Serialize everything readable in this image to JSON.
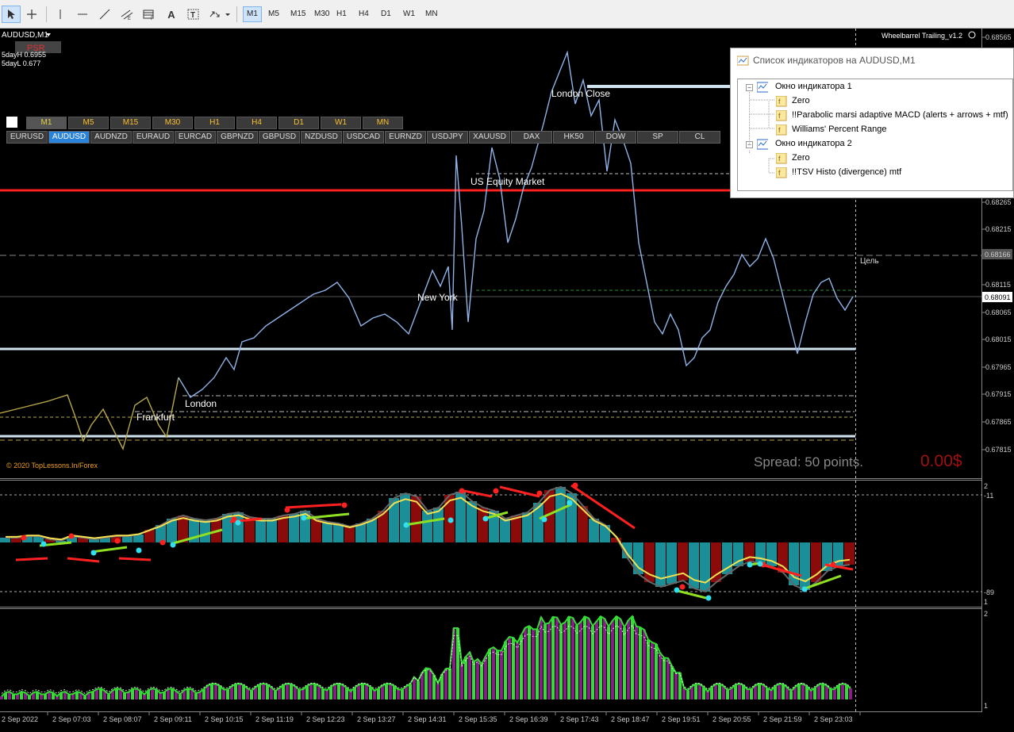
{
  "toolbar": {
    "timeframes": [
      "M1",
      "M5",
      "M15",
      "M30",
      "H1",
      "H4",
      "D1",
      "W1",
      "MN"
    ],
    "selected_timeframe": "M1",
    "tools": [
      "cursor-icon",
      "crosshair-icon",
      "vertical-line-icon",
      "horizontal-line-icon",
      "trendline-icon",
      "channel-icon",
      "fibonacci-icon",
      "text-icon",
      "text-label-icon",
      "arrows-icon"
    ]
  },
  "chart": {
    "symbol_title": "AUDUSD,M1",
    "psr_label": "PSR",
    "day_high": "5dayH 0.6955",
    "day_low": "5dayL 0.677",
    "copyright": "© 2020 TopLessons.In/Forex",
    "spread_text": "Spread: 50 points.",
    "profit_text": "0.00$",
    "ea_name": "Wheelbarrel Trailing_v1.2",
    "target_label": "Цель",
    "session_labels": {
      "london_close": "London Close",
      "us_equity": "US Equity Market",
      "new_york": "New York",
      "london": "London",
      "frankfurt": "Frankfurt"
    },
    "current_price": "0.68091",
    "target_price": "0.68166",
    "price_axis": [
      "0.68565",
      "0.68265",
      "0.68215",
      "0.68115",
      "0.68065",
      "0.68015",
      "0.67965",
      "0.67915",
      "0.67865",
      "0.67815"
    ],
    "time_axis": [
      "2 Sep 2022",
      "2 Sep 07:03",
      "2 Sep 08:07",
      "2 Sep 09:11",
      "2 Sep 10:15",
      "2 Sep 11:19",
      "2 Sep 12:23",
      "2 Sep 13:27",
      "2 Sep 14:31",
      "2 Sep 15:35",
      "2 Sep 16:39",
      "2 Sep 17:43",
      "2 Sep 18:47",
      "2 Sep 19:51",
      "2 Sep 20:55",
      "2 Sep 21:59",
      "2 Sep 23:03"
    ],
    "sub1_axis": [
      "2",
      "-11",
      "-89",
      "1"
    ],
    "sub2_axis": [
      "2",
      "1"
    ]
  },
  "timeframe_row": [
    "M1",
    "M5",
    "M15",
    "M30",
    "H1",
    "H4",
    "D1",
    "W1",
    "MN"
  ],
  "timeframe_row_selected": "M1",
  "symbol_row": [
    "EURUSD",
    "AUDUSD",
    "AUDNZD",
    "EURAUD",
    "EURCAD",
    "GBPNZD",
    "GBPUSD",
    "NZDUSD",
    "USDCAD",
    "EURNZD",
    "USDJPY",
    "XAUUSD",
    "DAX",
    "HK50",
    "DOW",
    "SP",
    "CL"
  ],
  "symbol_row_selected": "AUDUSD",
  "indicators_panel": {
    "title": "Список индикаторов на AUDUSD,M1",
    "window1": "Окно индикатора 1",
    "window1_items": [
      "Zero",
      "!!Parabolic marsi adaptive MACD (alerts + arrows + mtf)",
      "Williams' Percent Range"
    ],
    "window2": "Окно индикатора 2",
    "window2_items": [
      "Zero",
      "!!TSV Histo (divergence) mtf"
    ]
  },
  "colors": {
    "candles": "#8fb3e8",
    "candles_old": "#b8a84a",
    "red_line": "#ff2020",
    "light_line": "#cfe3ef",
    "macd_up": "#1a8f98",
    "macd_down": "#8b0a0a",
    "tsv_green": "#33dd33",
    "tsv_purple": "#8a1c8a"
  }
}
